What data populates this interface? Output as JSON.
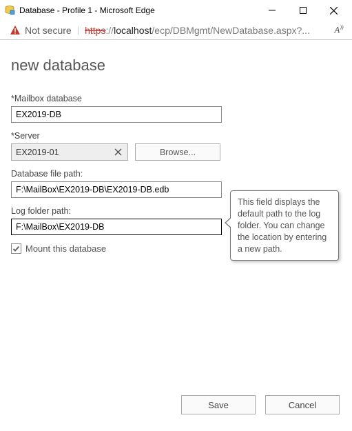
{
  "window": {
    "title": "Database - Profile 1 - Microsoft Edge"
  },
  "addressbar": {
    "not_secure": "Not secure",
    "protocol": "https",
    "sep": "://",
    "host": "localhost",
    "rest": "/ecp/DBMgmt/NewDatabase.aspx?..."
  },
  "page": {
    "title": "new database"
  },
  "form": {
    "mailbox_db_label": "*Mailbox database",
    "mailbox_db_value": "EX2019-DB",
    "server_label": "*Server",
    "server_value": "EX2019-01",
    "browse_label": "Browse...",
    "db_path_label": "Database file path:",
    "db_path_value": "F:\\MailBox\\EX2019-DB\\EX2019-DB.edb",
    "log_path_label": "Log folder path:",
    "log_path_value": "F:\\MailBox\\EX2019-DB",
    "mount_label": "Mount this database",
    "mount_checked": true
  },
  "tooltip": {
    "text": "This field displays the default path to the log folder. You can change the location by entering a new path."
  },
  "footer": {
    "save": "Save",
    "cancel": "Cancel"
  }
}
